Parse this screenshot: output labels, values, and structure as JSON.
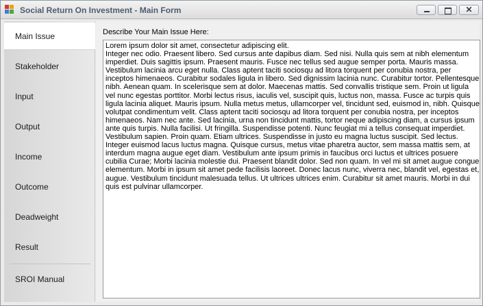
{
  "window": {
    "title": "Social Return On Investment - Main Form",
    "close_glyph": "✕"
  },
  "sidebar": {
    "items": [
      {
        "label": "Main Issue",
        "active": true
      },
      {
        "label": "Stakeholder"
      },
      {
        "label": "Input"
      },
      {
        "label": "Output"
      },
      {
        "label": "Income"
      },
      {
        "label": "Outcome"
      },
      {
        "label": "Deadweight"
      },
      {
        "label": "Result"
      },
      {
        "label": "SROI Manual"
      }
    ]
  },
  "main": {
    "label": "Describe Your Main Issue Here:",
    "issue_text": "Lorem ipsum dolor sit amet, consectetur adipiscing elit.\nInteger nec odio. Praesent libero. Sed cursus ante dapibus diam. Sed nisi. Nulla quis sem at nibh elementum imperdiet. Duis sagittis ipsum. Praesent mauris. Fusce nec tellus sed augue semper porta. Mauris massa. Vestibulum lacinia arcu eget nulla. Class aptent taciti sociosqu ad litora torquent per conubia nostra, per inceptos himenaeos. Curabitur sodales ligula in libero. Sed dignissim lacinia nunc. Curabitur tortor. Pellentesque nibh. Aenean quam. In scelerisque sem at dolor. Maecenas mattis. Sed convallis tristique sem. Proin ut ligula vel nunc egestas porttitor. Morbi lectus risus, iaculis vel, suscipit quis, luctus non, massa. Fusce ac turpis quis ligula lacinia aliquet. Mauris ipsum. Nulla metus metus, ullamcorper vel, tincidunt sed, euismod in, nibh. Quisque volutpat condimentum velit. Class aptent taciti sociosqu ad litora torquent per conubia nostra, per inceptos himenaeos. Nam nec ante. Sed lacinia, urna non tincidunt mattis, tortor neque adipiscing diam, a cursus ipsum ante quis turpis. Nulla facilisi. Ut fringilla. Suspendisse potenti. Nunc feugiat mi a tellus consequat imperdiet. Vestibulum sapien. Proin quam. Etiam ultrices. Suspendisse in justo eu magna luctus suscipit. Sed lectus. Integer euismod lacus luctus magna. Quisque cursus, metus vitae pharetra auctor, sem massa mattis sem, at interdum magna augue eget diam. Vestibulum ante ipsum primis in faucibus orci luctus et ultrices posuere cubilia Curae; Morbi lacinia molestie dui. Praesent blandit dolor. Sed non quam. In vel mi sit amet augue congue elementum. Morbi in ipsum sit amet pede facilisis laoreet. Donec lacus nunc, viverra nec, blandit vel, egestas et, augue. Vestibulum tincidunt malesuada tellus. Ut ultrices ultrices enim. Curabitur sit amet mauris. Morbi in dui quis est pulvinar ullamcorper."
  }
}
